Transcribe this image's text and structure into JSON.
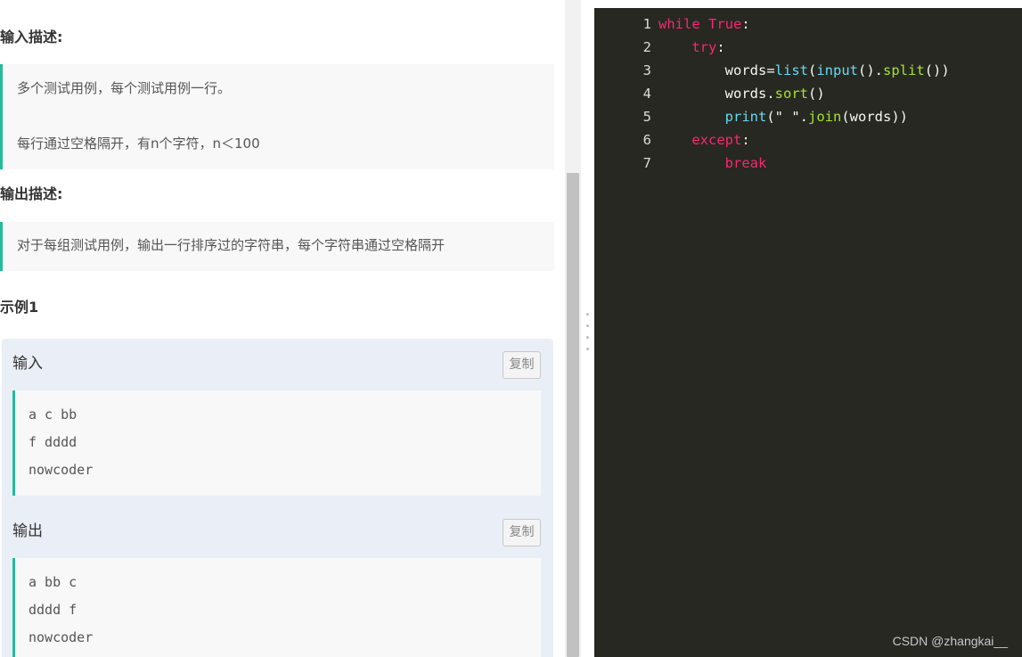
{
  "problem": {
    "input_desc_heading": "输入描述:",
    "input_desc_lines": [
      "多个测试用例，每个测试用例一行。",
      "每行通过空格隔开，有n个字符，n＜100"
    ],
    "output_desc_heading": "输出描述:",
    "output_desc_text": "对于每组测试用例，输出一行排序过的字符串，每个字符串通过空格隔开",
    "example_heading": "示例1",
    "example": {
      "input_label": "输入",
      "input_lines": [
        "a c bb",
        "f dddd",
        "nowcoder"
      ],
      "output_label": "输出",
      "output_lines": [
        "a bb c",
        "dddd f",
        "nowcoder"
      ],
      "copy_label": "复制"
    }
  },
  "editor": {
    "line_numbers": [
      "1",
      "2",
      "3",
      "4",
      "5",
      "6",
      "7"
    ],
    "lines": [
      [
        {
          "t": "while",
          "c": "kw"
        },
        {
          "t": " ",
          "c": "pl"
        },
        {
          "t": "True",
          "c": "kw"
        },
        {
          "t": ":",
          "c": "pl"
        }
      ],
      [
        {
          "t": "    ",
          "c": "pl"
        },
        {
          "t": "try",
          "c": "kw"
        },
        {
          "t": ":",
          "c": "pl"
        }
      ],
      [
        {
          "t": "        words",
          "c": "pl"
        },
        {
          "t": "=",
          "c": "pl"
        },
        {
          "t": "list",
          "c": "fn"
        },
        {
          "t": "(",
          "c": "pl"
        },
        {
          "t": "input",
          "c": "fn"
        },
        {
          "t": "().",
          "c": "pl"
        },
        {
          "t": "split",
          "c": "mt"
        },
        {
          "t": "())",
          "c": "pl"
        }
      ],
      [
        {
          "t": "        words.",
          "c": "pl"
        },
        {
          "t": "sort",
          "c": "mt"
        },
        {
          "t": "()",
          "c": "pl"
        }
      ],
      [
        {
          "t": "        ",
          "c": "pl"
        },
        {
          "t": "print",
          "c": "fn"
        },
        {
          "t": "(\" \".",
          "c": "pl"
        },
        {
          "t": "join",
          "c": "mt"
        },
        {
          "t": "(words))",
          "c": "pl"
        }
      ],
      [
        {
          "t": "    ",
          "c": "pl"
        },
        {
          "t": "except",
          "c": "kw"
        },
        {
          "t": ":",
          "c": "pl"
        }
      ],
      [
        {
          "t": "        ",
          "c": "pl"
        },
        {
          "t": "break",
          "c": "kw"
        }
      ]
    ]
  },
  "watermark": "CSDN @zhangkai__",
  "colors": {
    "accent_green": "#25bb9b",
    "editor_bg": "#272822",
    "keyword": "#f92672",
    "builtin": "#66d9ef",
    "method": "#a6e22e"
  }
}
